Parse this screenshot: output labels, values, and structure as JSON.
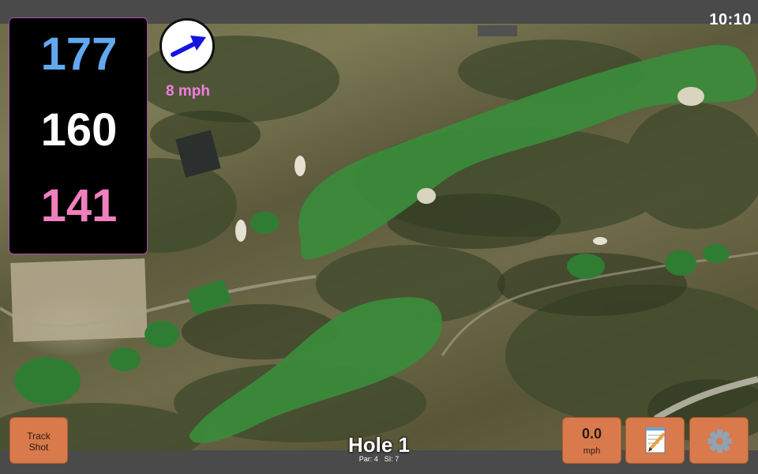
{
  "status": {
    "time": "10:10"
  },
  "distances": {
    "back": "177",
    "middle": "160",
    "front": "141"
  },
  "wind": {
    "speed": "8 mph",
    "icon": "wind-arrow-icon"
  },
  "hole": {
    "title": "Hole 1",
    "par": "Par: 4",
    "si": "SI: 7"
  },
  "buttons": {
    "track_shot": [
      "Track",
      "Shot"
    ],
    "speed_value": "0.0",
    "speed_unit": "mph",
    "notes_icon": "notepad-icon",
    "settings_icon": "gear-icon"
  },
  "colors": {
    "back_distance": "#62a8ef",
    "middle_distance": "#ffffff",
    "front_distance": "#f07fbe",
    "wind_text": "#f07fe0",
    "button_bg": "#d97a4c"
  }
}
